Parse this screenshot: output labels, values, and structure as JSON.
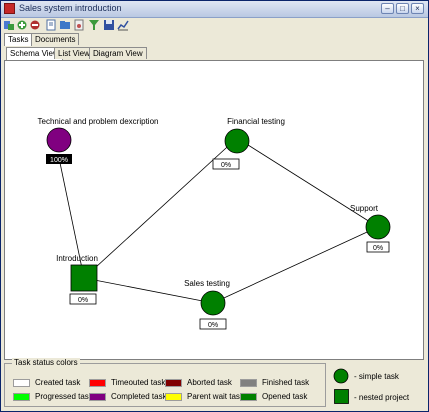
{
  "window": {
    "title": "Sales system introduction",
    "controls": [
      "minimize-icon",
      "maximize-icon",
      "close-icon"
    ]
  },
  "toolbar": {
    "buttons": [
      "new-task-icon",
      "add-icon",
      "remove-icon",
      "document-icon",
      "open-icon",
      "attach-icon",
      "filter-icon",
      "save-icon",
      "chart-icon"
    ]
  },
  "main_tabs": {
    "tasks": "Tasks",
    "documents": "Documents"
  },
  "view_tabs": {
    "schema": "Schema View",
    "list": "List View",
    "diagram": "Diagram View"
  },
  "diagram": {
    "nodes": [
      {
        "id": "tech",
        "label": "Technical and problem dexcription",
        "percent": "100%",
        "shape": "circle",
        "status": "Completed task",
        "fill": "#800080"
      },
      {
        "id": "financial",
        "label": "Financial testing",
        "percent": "0%",
        "shape": "circle",
        "status": "Opened task",
        "fill": "#008000"
      },
      {
        "id": "support",
        "label": "Support",
        "percent": "0%",
        "shape": "circle",
        "status": "Opened task",
        "fill": "#008000"
      },
      {
        "id": "intro",
        "label": "Introduction",
        "percent": "0%",
        "shape": "square",
        "status": "Opened task",
        "fill": "#008000"
      },
      {
        "id": "sales",
        "label": "Sales testing",
        "percent": "0%",
        "shape": "circle",
        "status": "Opened task",
        "fill": "#008000"
      }
    ],
    "edges": [
      [
        "tech",
        "intro"
      ],
      [
        "intro",
        "financial"
      ],
      [
        "intro",
        "sales"
      ],
      [
        "financial",
        "support"
      ],
      [
        "sales",
        "support"
      ]
    ]
  },
  "status_colors": {
    "title": "Task status colors",
    "items": [
      {
        "label": "Created task",
        "color": "#ffffff"
      },
      {
        "label": "Progressed task",
        "color": "#00ff00"
      },
      {
        "label": "Timeouted task",
        "color": "#ff0000"
      },
      {
        "label": "Completed task",
        "color": "#800080"
      },
      {
        "label": "Aborted task",
        "color": "#800000"
      },
      {
        "label": "Parent wait task",
        "color": "#ffff00"
      },
      {
        "label": "Finished task",
        "color": "#808080"
      },
      {
        "label": "Opened task",
        "color": "#008000"
      }
    ]
  },
  "shape_legend": {
    "simple": "- simple task",
    "nested": "- nested project"
  }
}
